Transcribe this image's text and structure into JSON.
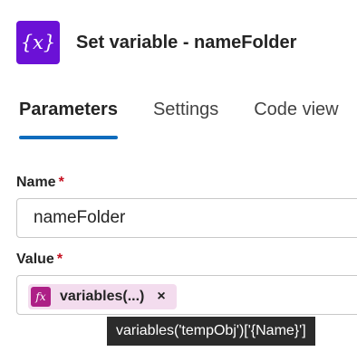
{
  "header": {
    "icon_glyph": "{x}",
    "icon_name": "variable-icon",
    "title": "Set variable - nameFolder"
  },
  "tabs": [
    {
      "label": "Parameters",
      "active": true
    },
    {
      "label": "Settings",
      "active": false
    },
    {
      "label": "Code view",
      "active": false
    }
  ],
  "form": {
    "name": {
      "label": "Name",
      "required_mark": "*",
      "value": "nameFolder"
    },
    "value": {
      "label": "Value",
      "required_mark": "*",
      "token": {
        "icon_glyph": "fx",
        "label": "variables(...)",
        "close_glyph": "×"
      }
    }
  },
  "tooltip": {
    "text": "variables('tempObj')['{Name}']"
  },
  "colors": {
    "brand_purple": "#6b11d6",
    "token_bg": "#f3dcee",
    "token_icon": "#ad1f86",
    "tab_underline": "#0f6cbd",
    "tooltip_bg": "#2b2b2b"
  }
}
